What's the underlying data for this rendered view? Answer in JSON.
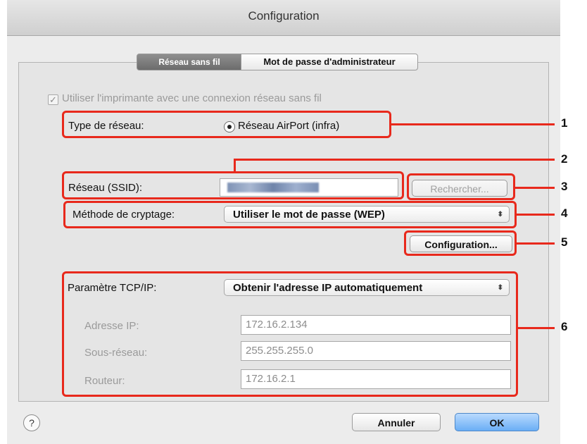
{
  "window": {
    "title": "Configuration"
  },
  "tabs": {
    "wireless": "Réseau sans fil",
    "admin_password": "Mot de passe d'administrateur"
  },
  "use_wireless": {
    "label": "Utiliser l'imprimante avec une connexion réseau sans fil",
    "checked": true
  },
  "network_type": {
    "label": "Type de réseau:",
    "option": "Réseau AirPort (infra)"
  },
  "ssid": {
    "label": "Réseau (SSID):"
  },
  "search_button": "Rechercher...",
  "encryption": {
    "label": "Méthode de cryptage:",
    "value": "Utiliser le mot de passe (WEP)"
  },
  "config_button": "Configuration...",
  "tcpip": {
    "label": "Paramètre TCP/IP:",
    "value": "Obtenir l'adresse IP automatiquement",
    "ip_label": "Adresse IP:",
    "ip_value": "172.16.2.134",
    "subnet_label": "Sous-réseau:",
    "subnet_value": "255.255.255.0",
    "router_label": "Routeur:",
    "router_value": "172.16.2.1"
  },
  "help": "?",
  "buttons": {
    "cancel": "Annuler",
    "ok": "OK"
  },
  "callouts": {
    "c1": "1",
    "c2": "2",
    "c3": "3",
    "c4": "4",
    "c5": "5",
    "c6": "6"
  },
  "colors": {
    "callout_red": "#e8291c",
    "default_button": "#6aaef5"
  }
}
